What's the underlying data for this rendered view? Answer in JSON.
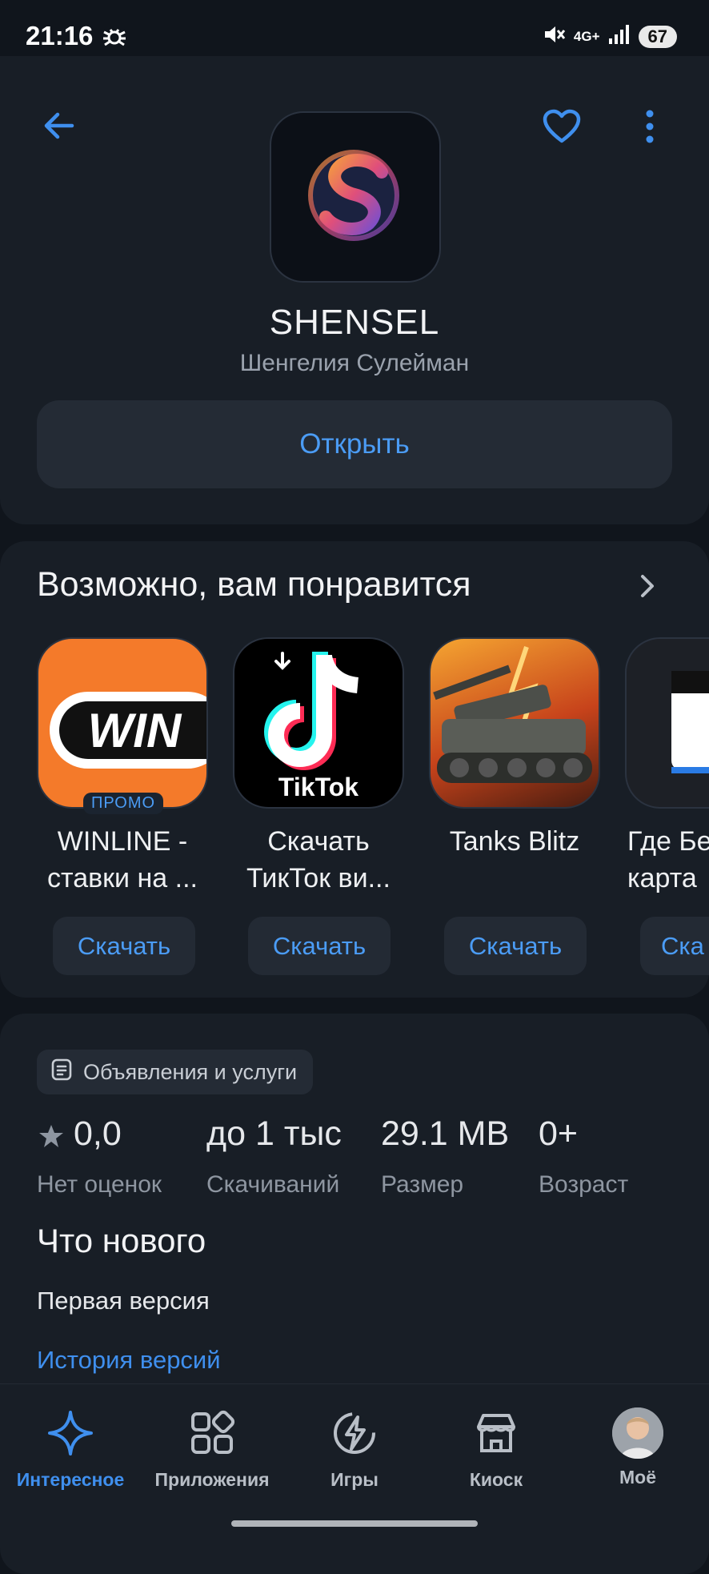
{
  "status": {
    "time": "21:16",
    "network": "4G+",
    "battery": "67"
  },
  "app": {
    "name": "SHENSEL",
    "developer": "Шенгелия Сулейман",
    "open_label": "Открыть",
    "icon": "s-logo-icon"
  },
  "recommendations": {
    "title": "Возможно, вам понравится",
    "items": [
      {
        "name_line1": "WINLINE -",
        "name_line2": "ставки на ...",
        "badge": "ПРОМО",
        "button": "Скачать",
        "tile_text": "WIN",
        "accent": "#f47a2a"
      },
      {
        "name_line1": "Скачать",
        "name_line2": "ТикТок ви...",
        "button": "Скачать",
        "tile_text": "TikTok"
      },
      {
        "name_line1": "Tanks Blitz",
        "name_line2": "",
        "button": "Скачать"
      },
      {
        "name_line1": "Где Бе",
        "name_line2": "карта",
        "button": "Ска"
      }
    ]
  },
  "info": {
    "category": "Объявления и услуги",
    "stats": [
      {
        "value": "0,0",
        "label": "Нет оценок"
      },
      {
        "value": "до 1 тыс",
        "label": "Скачиваний"
      },
      {
        "value": "29.1 MB",
        "label": "Размер"
      },
      {
        "value": "0+",
        "label": "Возраст"
      }
    ],
    "whats_new_title": "Что нового",
    "whats_new_text": "Первая версия",
    "history_link": "История версий"
  },
  "nav": [
    {
      "label": "Интересное",
      "icon": "sparkle-icon",
      "active": true
    },
    {
      "label": "Приложения",
      "icon": "apps-grid-icon"
    },
    {
      "label": "Игры",
      "icon": "games-bolt-icon"
    },
    {
      "label": "Киоск",
      "icon": "store-icon"
    },
    {
      "label": "Моё",
      "icon": "avatar"
    }
  ],
  "colors": {
    "accent": "#3f8fee",
    "background": "#10151c",
    "card": "#181e26"
  }
}
